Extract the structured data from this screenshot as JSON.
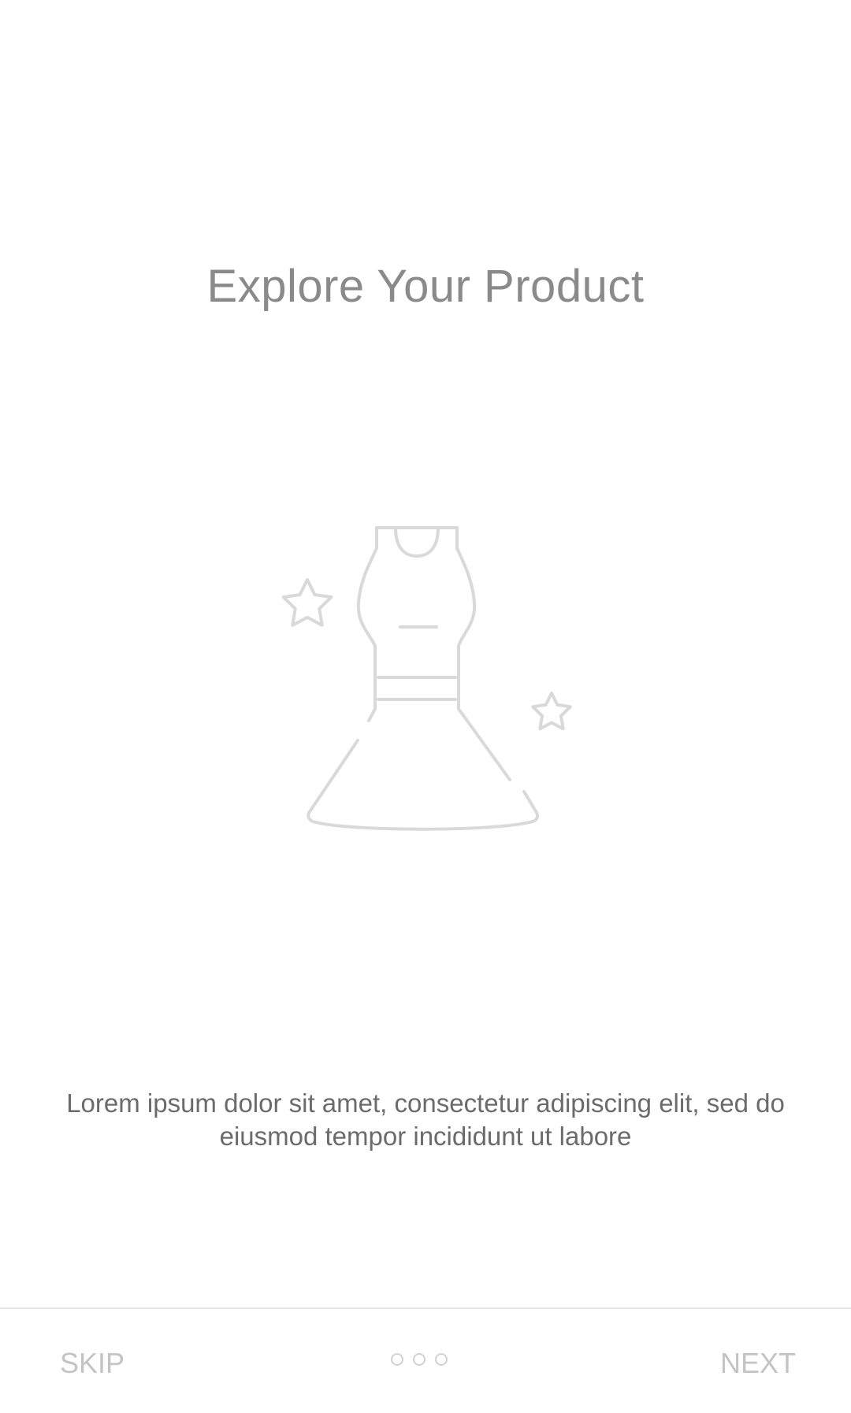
{
  "onboarding": {
    "title": "Explore Your Product",
    "illustration_icon": "dress-with-stars-icon",
    "description": "Lorem ipsum dolor sit amet, consectetur adipiscing elit, sed do eiusmod tempor incididunt ut labore"
  },
  "footer": {
    "skip_label": "SKIP",
    "next_label": "NEXT",
    "page_count": 3
  },
  "colors": {
    "title": "#8a8a8a",
    "body_text": "#6b6b6b",
    "muted_button": "#c4c4c4",
    "illustration_stroke": "#d9d9d9",
    "divider": "#e6e6e6"
  }
}
